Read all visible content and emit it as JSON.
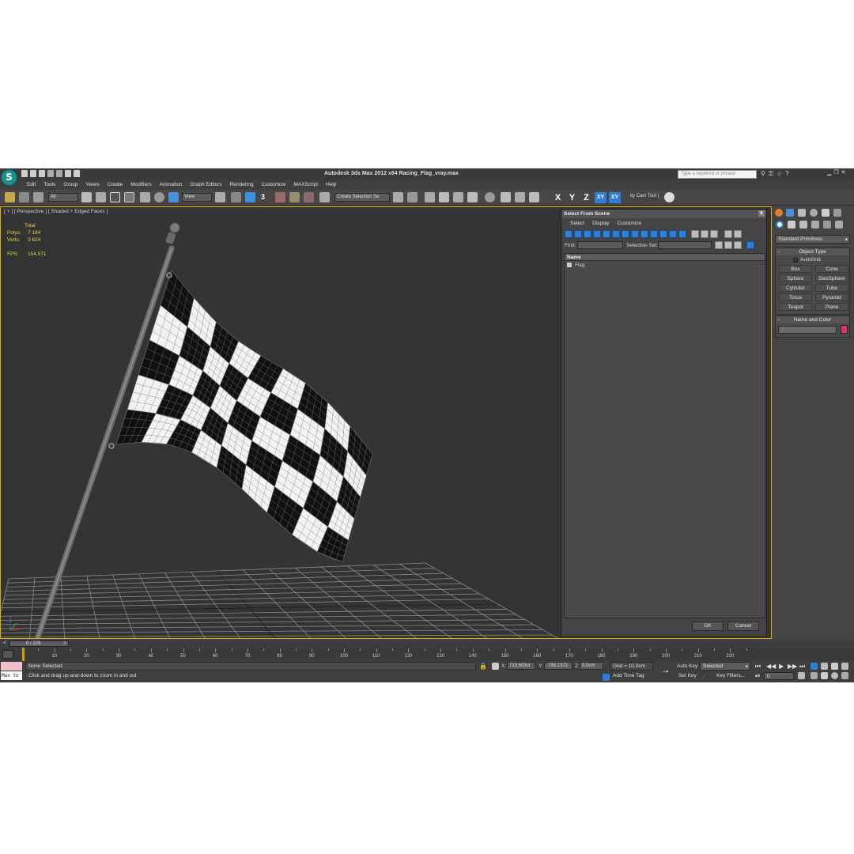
{
  "app": {
    "logo": "S",
    "title": "Autodesk 3ds Max  2012 x64     Racing_Flag_vray.max",
    "search_placeholder": "Type a keyword or phrase"
  },
  "menus": [
    "Edit",
    "Tools",
    "Group",
    "Views",
    "Create",
    "Modifiers",
    "Animation",
    "Graph Editors",
    "Rendering",
    "Customize",
    "MAXScript",
    "Help"
  ],
  "toolbar": {
    "filter_value": "All",
    "ref_coord_value": "View",
    "snap_label": "3",
    "selection_set_placeholder": "Create Selection Se",
    "axis_x": "X",
    "axis_y": "Y",
    "axis_z": "Z",
    "axis_xy": "XY",
    "axis_xy2": "XY",
    "cam_tool": "ity Cam Tool ("
  },
  "viewport": {
    "label": "[ + ] [ Perspective ] [ Shaded + Edged Faces ]",
    "stats": {
      "total_label": "Total",
      "polys_label": "Polys:",
      "polys_value": "7 184",
      "verts_label": "Verts:",
      "verts_value": "3 624",
      "fps_label": "FPS:",
      "fps_value": "154,571"
    }
  },
  "dialog": {
    "title": "Select From Scene",
    "close": "x",
    "menus": [
      "Select",
      "Display",
      "Customize"
    ],
    "find_label": "Find:",
    "selection_set_label": "Selection Set:",
    "column_name": "Name",
    "items": [
      "Flag"
    ],
    "ok_label": "OK",
    "cancel_label": "Cancel"
  },
  "command_panel": {
    "category": "Standard Primitives",
    "object_type_title": "Object Type",
    "autogrid_label": "AutoGrid",
    "object_buttons": [
      "Box",
      "Cone",
      "Sphere",
      "GeoSphere",
      "Cylinder",
      "Tube",
      "Torus",
      "Pyramid",
      "Teapot",
      "Plane"
    ],
    "name_color_title": "Name and Color",
    "object_color": "#e0307a"
  },
  "timeline": {
    "slider_label": "0 / 225",
    "ticks": [
      "10",
      "20",
      "30",
      "40",
      "50",
      "60",
      "70",
      "80",
      "90",
      "100",
      "110",
      "120",
      "130",
      "140",
      "150",
      "160",
      "170",
      "180",
      "190",
      "200",
      "210",
      "220"
    ]
  },
  "status": {
    "listener_text": "Max to",
    "selection_text": "None Selected",
    "prompt": "Click and drag up-and-down to zoom in and out",
    "x_label": "X:",
    "x_value": "713,503cr",
    "y_label": "Y:",
    "y_value": "-799,2372",
    "z_label": "Z:",
    "z_value": "0,0cm",
    "grid": "Grid = 10,0cm",
    "add_time_tag": "Add Time Tag",
    "auto_key": "Auto Key",
    "key_mode": "Selected",
    "set_key": "Set Key",
    "key_filters": "Key Filters...",
    "current_frame": "0"
  },
  "colors": {
    "viewport_border": "#e0b000",
    "stats_text": "#e6d23c",
    "accent_blue": "#2d7fd6"
  }
}
